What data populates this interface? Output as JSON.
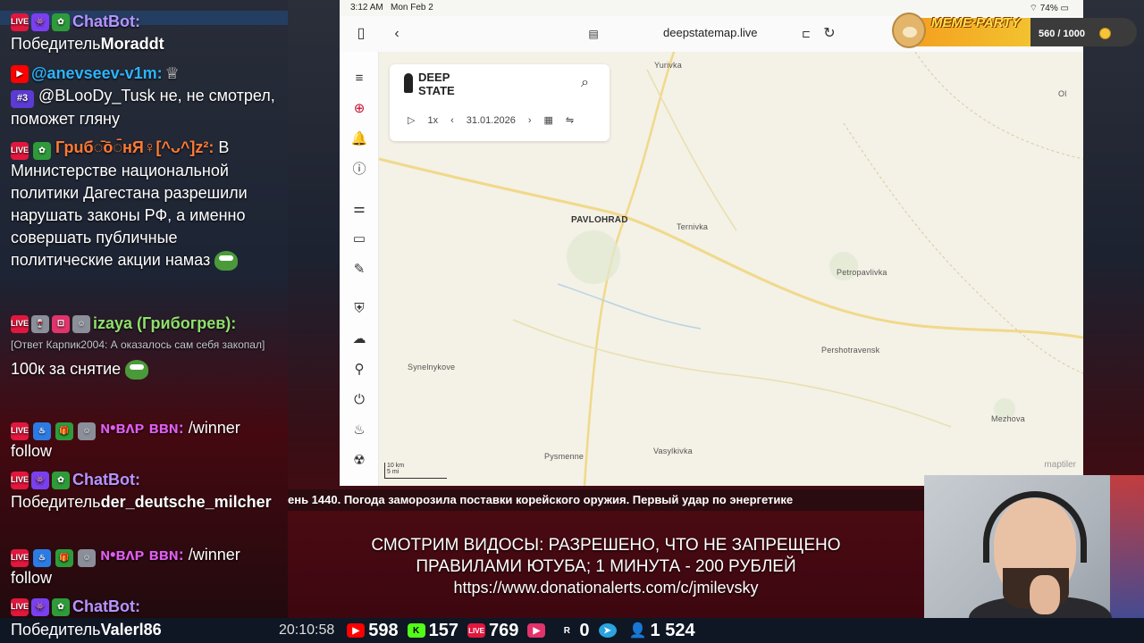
{
  "chat": {
    "messages": [
      {
        "nick": "ChatBot:",
        "text_prefix": "Победитель",
        "text_bold": "Moraddt"
      },
      {
        "nick": "@anevseev-v1m:",
        "crown": "♕",
        "badge_num": "#3",
        "text": "@BLooDy_Tusk не, не смотрел, поможет гляну"
      },
      {
        "nick": "Грuб◌̄ō◌̄нЯ♀[^ᴗ^]z²:",
        "text": "В Министерстве национальной политики Дагестана разрешили нарушать законы РФ, а именно совершать публичные политические акции намаз"
      },
      {
        "nick": "izaya (Грибогрев):",
        "reply": "[Ответ Карпик2004: А оказалось сам себя закопал]",
        "text": "100к за снятие"
      },
      {
        "nick": "ɴ•ʙᴧᴩ ʙʙɴ:",
        "text": "/winner follow"
      },
      {
        "nick": "ChatBot:",
        "text_prefix": "Победитель",
        "text_bold": "der_deutsche_milcher"
      },
      {
        "nick": "ɴ•ʙᴧᴩ ʙʙɴ:",
        "text": "/winner follow"
      },
      {
        "nick": "ChatBot:",
        "text_prefix": "Победитель",
        "text_bold": "Valerl86"
      }
    ]
  },
  "tablet": {
    "time": "3:12 AM",
    "date": "Mon Feb 2",
    "battery": "74%",
    "url": "deepstatemap.live",
    "deepstate": {
      "logo_line1": "DEEP",
      "logo_line2": "STATE",
      "speed": "1x",
      "date": "31.01.2026"
    },
    "places": {
      "yurivka": "Yurivka",
      "pavlohrad": "PAVLOHRAD",
      "ternivka": "Ternivka",
      "petropavlivka": "Petropavlivka",
      "pershotravensk": "Pershotravensk",
      "synelnykove": "Synelnykove",
      "mezhova": "Mezhova",
      "pysmenne": "Pysmenne",
      "vasylkivka": "Vasylkivka",
      "ol": "Ol"
    },
    "scale_km": "10 km",
    "scale_mi": "5 mi",
    "attribution": "maptiler"
  },
  "meme_party": {
    "title": "MEME·PARTY",
    "progress_text": "560 / 1000",
    "progress_fraction": 0.56
  },
  "ticker": "ень 1440. Погода заморозила поставки корейского оружия. Первый удар по энергетике",
  "donation": {
    "line1": "СМОТРИМ ВИДОСЫ: РАЗРЕШЕНО, ЧТО НЕ ЗАПРЕЩЕНО",
    "line2": "ПРАВИЛАМИ ЮТУБА; 1 МИНУТА - 200 РУБЛЕЙ",
    "line3": "https://www.donationalerts.com/c/jmilevsky"
  },
  "stats": {
    "clock": "20:10:58",
    "youtube": "598",
    "kick": "157",
    "live": "769",
    "vk": "",
    "rumble": "0",
    "telegram": "",
    "total": "1 524"
  },
  "colors": {
    "accent_bot": "#b793ff",
    "accent_cyan": "#2cb4ff",
    "map_bg": "#f4f1e6",
    "meme_fill": "#f59b1c"
  }
}
